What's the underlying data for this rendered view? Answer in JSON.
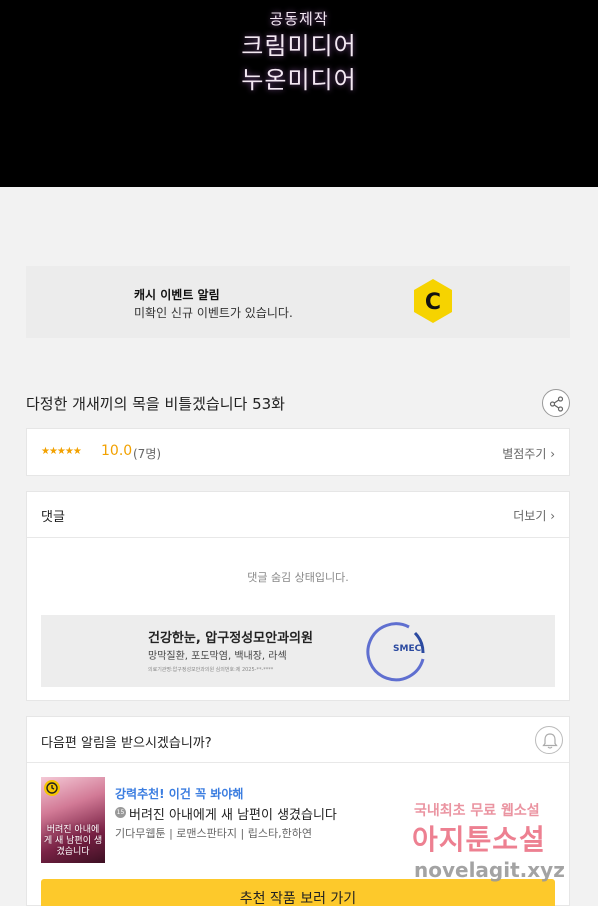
{
  "hero": {
    "credit_small": "공동제작",
    "credit_line1": "크림미디어",
    "credit_line2": "누온미디어"
  },
  "cash_event": {
    "title": "캐시 이벤트 알림",
    "subtitle": "미확인 신규 이벤트가 있습니다.",
    "logo_letter": "C"
  },
  "episode": {
    "title": "다정한 개새끼의 목을 비틀겠습니다 53화"
  },
  "rating": {
    "stars": "★★★★★",
    "score": "10.0",
    "count": "(7명)",
    "rate_link": "별점주기 ›"
  },
  "comments": {
    "title": "댓글",
    "more": "더보기 ›",
    "hidden_msg": "댓글 숨김 상태입니다."
  },
  "ad": {
    "title": "건강한눈, 압구정성모안과의원",
    "subtitle": "망막질환, 포도막염, 백내장, 라섹",
    "fine_print": "의료기관명:압구정성모안과의원 심의번호:제 2025-**-****",
    "brand": "SMEC"
  },
  "notify": {
    "question": "다음편 알림을 받으시겠습니까?"
  },
  "recommend": {
    "tag": "강력추천! 이건 꼭 봐야해",
    "age_badge": "15",
    "title": "버려진 아내에게 새 남편이 생겼습니다",
    "meta": "기다무웹툰 | 로맨스판타지 | 립스타,한하연",
    "cover_text": "버려진 아내에게 새 남편이 생겼습니다",
    "cta": "추천 작품 보러 가기"
  },
  "watermark": {
    "line1": "국내최초 무료 웹소설",
    "line2": "아지툰소설",
    "line3": "novelagit.xyz"
  },
  "colors": {
    "accent_yellow": "#fdc92b",
    "star_orange": "#f2a100",
    "link_blue": "#3b7de0"
  }
}
